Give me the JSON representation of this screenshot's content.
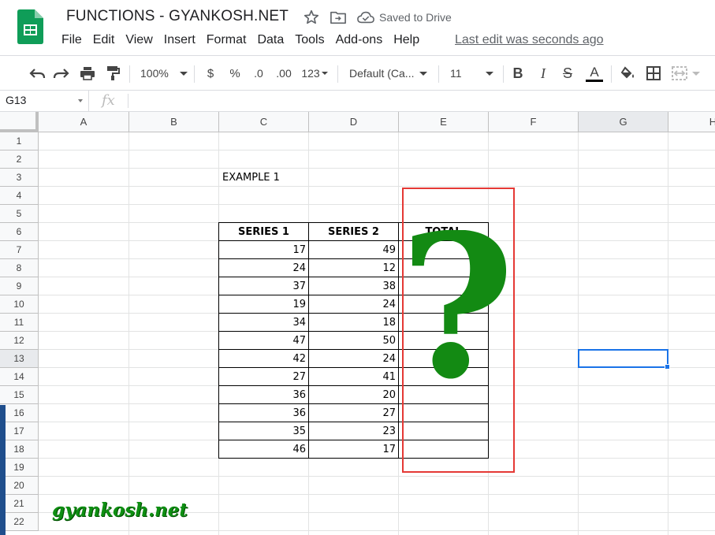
{
  "app": {
    "doc_title": "FUNCTIONS - GYANKOSH.NET",
    "saved_status": "Saved to Drive",
    "last_edit": "Last edit was seconds ago",
    "menu": [
      "File",
      "Edit",
      "View",
      "Insert",
      "Format",
      "Data",
      "Tools",
      "Add-ons",
      "Help"
    ]
  },
  "toolbar": {
    "zoom": "100%",
    "currency": "$",
    "percent": "%",
    "decrease_decimal": ".0",
    "increase_decimal": ".00",
    "more_formats": "123",
    "font": "Default (Ca...",
    "font_size": "11",
    "bold": "B",
    "italic": "I",
    "strike": "S",
    "text_color": "A",
    "icons": [
      "undo-icon",
      "redo-icon",
      "print-icon",
      "paint-format-icon",
      "fill-color-icon",
      "borders-icon",
      "merge-cells-icon"
    ]
  },
  "formula_bar": {
    "cell_ref": "G13",
    "fx": "fx",
    "content": ""
  },
  "sheet": {
    "columns": [
      "A",
      "B",
      "C",
      "D",
      "E",
      "F",
      "G",
      "H"
    ],
    "rows": [
      "1",
      "2",
      "3",
      "4",
      "5",
      "6",
      "7",
      "8",
      "9",
      "10",
      "11",
      "12",
      "13",
      "14",
      "15",
      "16",
      "17",
      "18",
      "19",
      "20",
      "21",
      "22"
    ],
    "selected_cell": "G13",
    "example_label": "EXAMPLE 1",
    "table": {
      "headers": [
        "SERIES 1",
        "SERIES 2",
        "TOTAL"
      ],
      "rows": [
        [
          "17",
          "49",
          ""
        ],
        [
          "24",
          "12",
          ""
        ],
        [
          "37",
          "38",
          ""
        ],
        [
          "19",
          "24",
          ""
        ],
        [
          "34",
          "18",
          ""
        ],
        [
          "47",
          "50",
          ""
        ],
        [
          "42",
          "24",
          ""
        ],
        [
          "27",
          "41",
          ""
        ],
        [
          "36",
          "20",
          ""
        ],
        [
          "36",
          "27",
          ""
        ],
        [
          "35",
          "23",
          ""
        ],
        [
          "46",
          "17",
          ""
        ]
      ]
    }
  },
  "overlay": {
    "question_mark": "?",
    "watermark": "gyankosh.net",
    "colors": {
      "highlight_box": "#e53935",
      "question_mark": "#138a13",
      "watermark": "#0e8f12",
      "selection": "#1a73e8"
    }
  }
}
